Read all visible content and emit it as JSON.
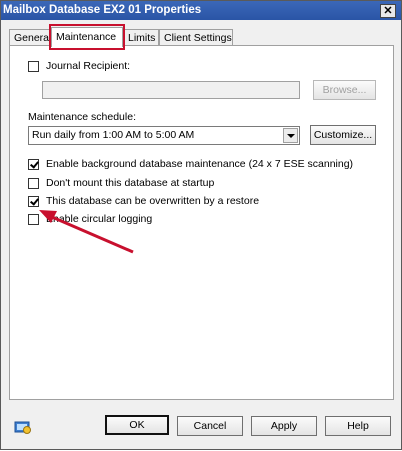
{
  "window": {
    "title": "Mailbox Database EX2 01 Properties",
    "close_label": "✕"
  },
  "tabs": [
    {
      "label": "General"
    },
    {
      "label": "Maintenance"
    },
    {
      "label": "Limits"
    },
    {
      "label": "Client Settings"
    }
  ],
  "maintenance": {
    "journal_recipient": {
      "label": "Journal Recipient:",
      "checked": false
    },
    "browse_label": "Browse...",
    "schedule_label": "Maintenance schedule:",
    "schedule_value": "Run daily from 1:00 AM to 5:00 AM",
    "customize_label": "Customize...",
    "options": [
      {
        "label": "Enable background database maintenance (24 x 7 ESE scanning)",
        "checked": true
      },
      {
        "label": "Don't mount this database at startup",
        "checked": false
      },
      {
        "label": "This database can be overwritten by a restore",
        "checked": true
      },
      {
        "label": "Enable circular logging",
        "checked": false
      }
    ]
  },
  "footer": {
    "ok_label": "OK",
    "cancel_label": "Cancel",
    "apply_label": "Apply",
    "help_label": "Help"
  },
  "colors": {
    "highlight_box": "#c8102e",
    "arrow": "#c8102e",
    "titlebar": "#2a55a6"
  }
}
